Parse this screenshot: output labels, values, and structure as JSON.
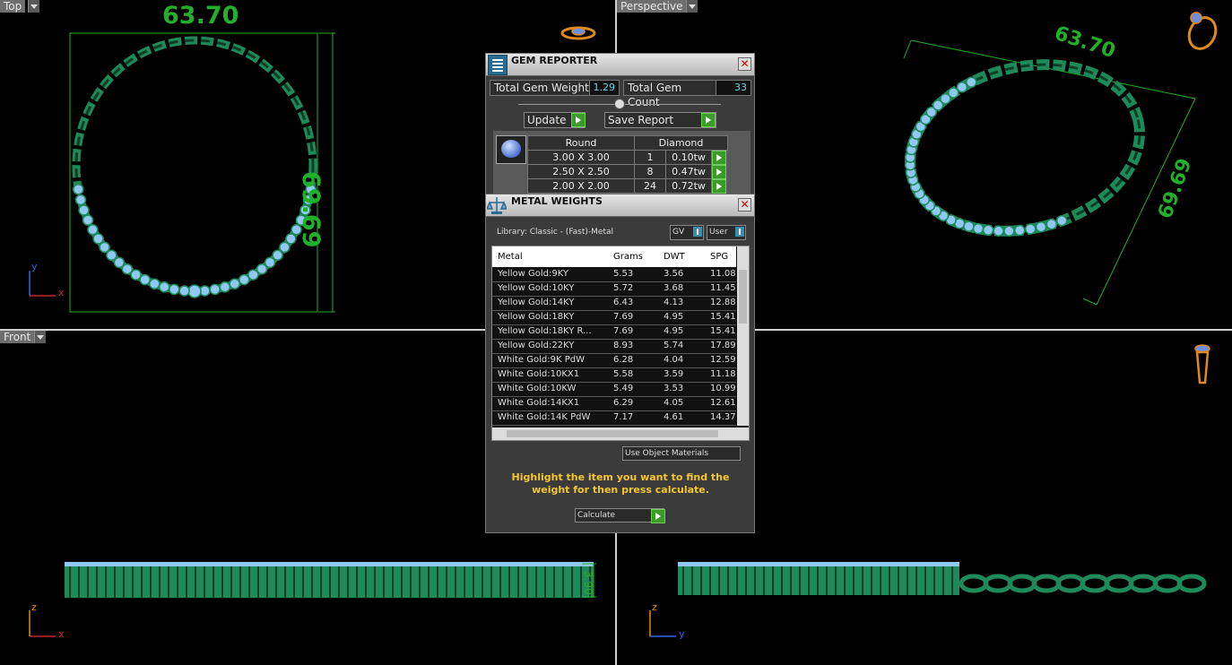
{
  "viewports": {
    "top": {
      "label": "Top",
      "dim_width": "63.70",
      "dim_height": "69.69"
    },
    "perspective": {
      "label": "Perspective",
      "dim_width": "63.70",
      "dim_height": "69.69"
    },
    "front": {
      "label": "Front",
      "dim_height": "3.90"
    }
  },
  "axes": {
    "x": "x",
    "y": "y",
    "z": "z"
  },
  "gem_reporter": {
    "title": "GEM REPORTER",
    "total_weight_label": "Total Gem Weight",
    "total_weight_value": "1.29",
    "total_count_label": "Total Gem Count",
    "total_count_value": "33",
    "update_label": "Update",
    "save_report_label": "Save Report",
    "table": {
      "shape": "Round",
      "material": "Diamond",
      "rows": [
        {
          "size": "3.00 X 3.00",
          "count": "1",
          "weight": "0.10tw"
        },
        {
          "size": "2.50 X 2.50",
          "count": "8",
          "weight": "0.47tw"
        },
        {
          "size": "2.00 X 2.00",
          "count": "24",
          "weight": "0.72tw"
        }
      ]
    }
  },
  "metal_weights": {
    "title": "METAL WEIGHTS",
    "library_label": "Library: Classic - (Fast)-Metal",
    "gv_label": "GV",
    "user_label": "User",
    "headers": {
      "metal": "Metal",
      "grams": "Grams",
      "dwt": "DWT",
      "spg": "SPG"
    },
    "rows": [
      {
        "metal": "Yellow Gold:9KY",
        "grams": "5.53",
        "dwt": "3.56",
        "spg": "11.08"
      },
      {
        "metal": "Yellow Gold:10KY",
        "grams": "5.72",
        "dwt": "3.68",
        "spg": "11.45"
      },
      {
        "metal": "Yellow Gold:14KY",
        "grams": "6.43",
        "dwt": "4.13",
        "spg": "12.88"
      },
      {
        "metal": "Yellow Gold:18KY",
        "grams": "7.69",
        "dwt": "4.95",
        "spg": "15.41"
      },
      {
        "metal": "Yellow Gold:18KY R...",
        "grams": "7.69",
        "dwt": "4.95",
        "spg": "15.41"
      },
      {
        "metal": "Yellow Gold:22KY",
        "grams": "8.93",
        "dwt": "5.74",
        "spg": "17.89"
      },
      {
        "metal": "White Gold:9K PdW",
        "grams": "6.28",
        "dwt": "4.04",
        "spg": "12.59"
      },
      {
        "metal": "White Gold:10KX1",
        "grams": "5.58",
        "dwt": "3.59",
        "spg": "11.18"
      },
      {
        "metal": "White Gold:10KW",
        "grams": "5.49",
        "dwt": "3.53",
        "spg": "10.99"
      },
      {
        "metal": "White Gold:14KX1",
        "grams": "6.29",
        "dwt": "4.05",
        "spg": "12.61"
      },
      {
        "metal": "White Gold:14K PdW",
        "grams": "7.17",
        "dwt": "4.61",
        "spg": "14.37"
      }
    ],
    "use_object_materials_label": "Use Object Materials",
    "message": "Highlight the item you want to find the weight for then press calculate.",
    "calculate_label": "Calculate"
  },
  "colors": {
    "model": "#1e8a5a",
    "gem": "#8fc8f0",
    "dimension": "#22b02a",
    "panel": "#3b3b3b"
  }
}
